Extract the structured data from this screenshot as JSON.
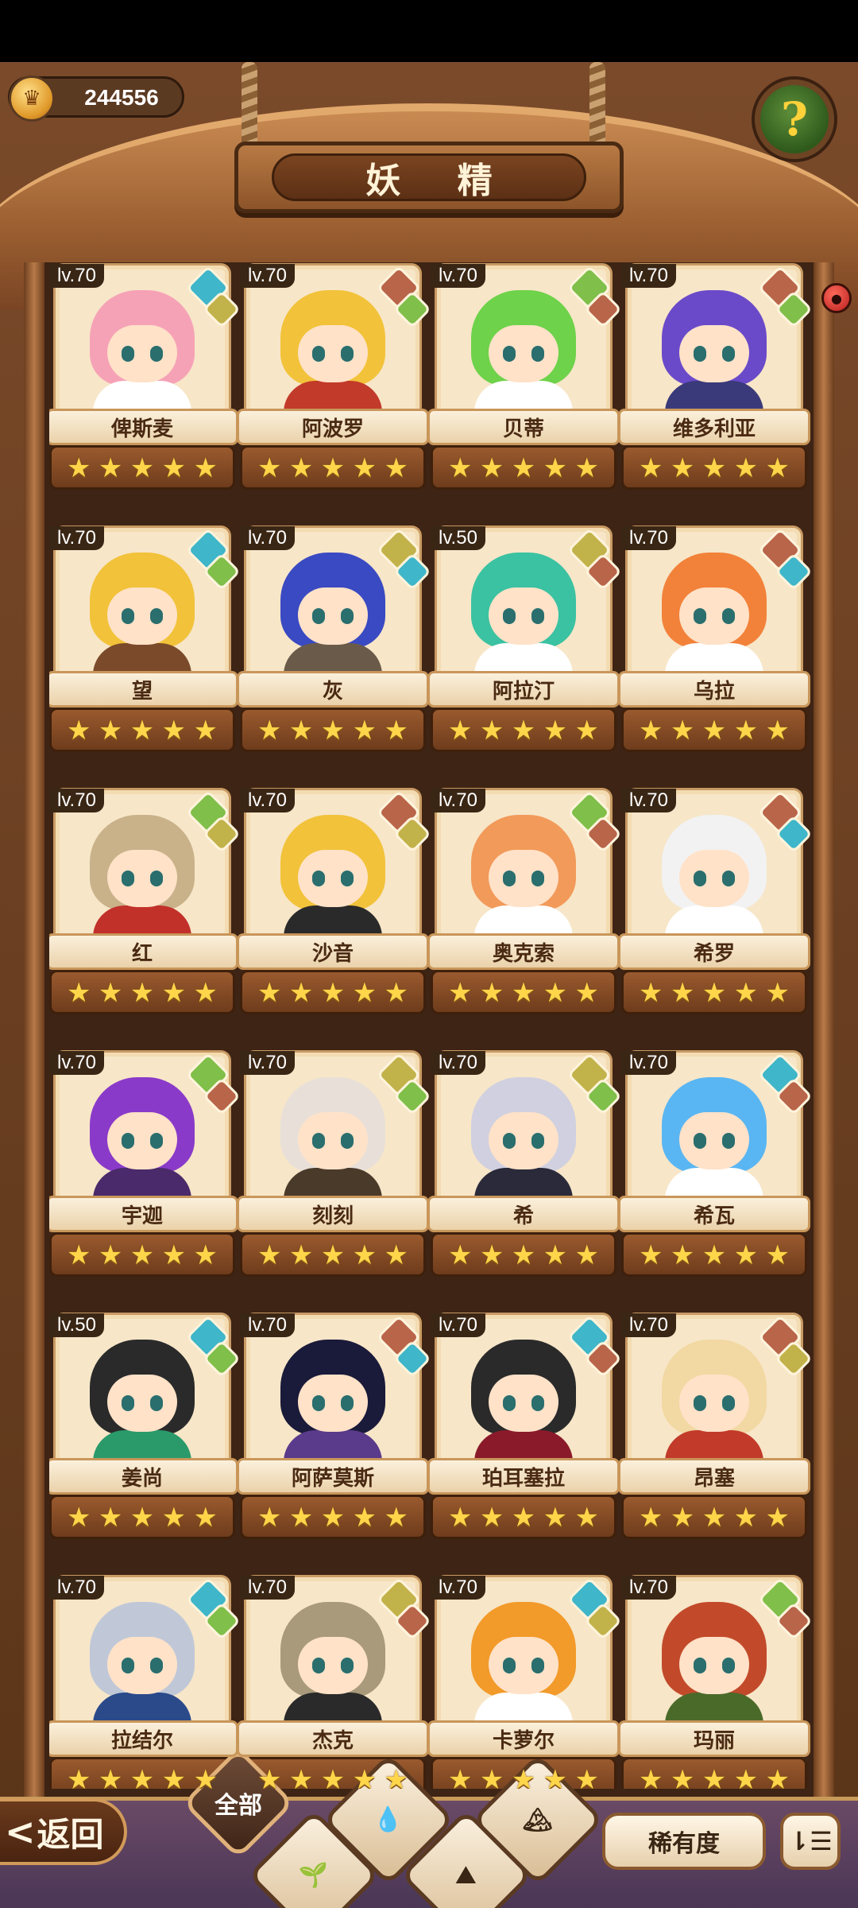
{
  "header": {
    "currency_value": "244556",
    "title": "妖 精",
    "help_glyph": "?"
  },
  "fairies": [
    {
      "level": "lv.70",
      "name": "俾斯麦",
      "stars": 5,
      "gems": [
        "#3fb6c9",
        "#c2b24a"
      ],
      "hair": "#f6a2b6",
      "outfit": "#ffffff"
    },
    {
      "level": "lv.70",
      "name": "阿波罗",
      "stars": 5,
      "gems": [
        "#b9654a",
        "#7fbf4a"
      ],
      "hair": "#f2c23a",
      "outfit": "#c23a2a"
    },
    {
      "level": "lv.70",
      "name": "贝蒂",
      "stars": 5,
      "gems": [
        "#7fbf4a",
        "#b9654a"
      ],
      "hair": "#6ed24a",
      "outfit": "#ffffff"
    },
    {
      "level": "lv.70",
      "name": "维多利亚",
      "stars": 5,
      "gems": [
        "#b9654a",
        "#7fbf4a"
      ],
      "hair": "#6a4ac9",
      "outfit": "#3a3a7a"
    },
    {
      "level": "lv.70",
      "name": "望",
      "stars": 5,
      "gems": [
        "#3fb6c9",
        "#7fbf4a"
      ],
      "hair": "#f2c23a",
      "outfit": "#7a4a2a"
    },
    {
      "level": "lv.70",
      "name": "灰",
      "stars": 5,
      "gems": [
        "#c2b24a",
        "#3fb6c9"
      ],
      "hair": "#3a4ac2",
      "outfit": "#6a5a4a"
    },
    {
      "level": "lv.50",
      "name": "阿拉汀",
      "stars": 5,
      "gems": [
        "#c2b24a",
        "#b9654a"
      ],
      "hair": "#3ac2a2",
      "outfit": "#ffffff"
    },
    {
      "level": "lv.70",
      "name": "乌拉",
      "stars": 5,
      "gems": [
        "#b9654a",
        "#3fb6c9"
      ],
      "hair": "#f2823a",
      "outfit": "#ffffff"
    },
    {
      "level": "lv.70",
      "name": "红",
      "stars": 5,
      "gems": [
        "#7fbf4a",
        "#c2b24a"
      ],
      "hair": "#c9b28a",
      "outfit": "#c2302a"
    },
    {
      "level": "lv.70",
      "name": "沙音",
      "stars": 5,
      "gems": [
        "#b9654a",
        "#c2b24a"
      ],
      "hair": "#f2c23a",
      "outfit": "#2a2a2a"
    },
    {
      "level": "lv.70",
      "name": "奥克索",
      "stars": 5,
      "gems": [
        "#7fbf4a",
        "#b9654a"
      ],
      "hair": "#f29a5a",
      "outfit": "#ffffff"
    },
    {
      "level": "lv.70",
      "name": "希罗",
      "stars": 5,
      "gems": [
        "#b9654a",
        "#3fb6c9"
      ],
      "hair": "#f2f2f2",
      "outfit": "#ffffff"
    },
    {
      "level": "lv.70",
      "name": "宇迦",
      "stars": 5,
      "gems": [
        "#7fbf4a",
        "#b9654a"
      ],
      "hair": "#8a3ac9",
      "outfit": "#4a2a6a"
    },
    {
      "level": "lv.70",
      "name": "刻刻",
      "stars": 5,
      "gems": [
        "#c2b24a",
        "#7fbf4a"
      ],
      "hair": "#e8e0d8",
      "outfit": "#4a3a2a"
    },
    {
      "level": "lv.70",
      "name": "希",
      "stars": 5,
      "gems": [
        "#c2b24a",
        "#7fbf4a"
      ],
      "hair": "#d0d0e0",
      "outfit": "#2a2a3a"
    },
    {
      "level": "lv.70",
      "name": "希瓦",
      "stars": 5,
      "gems": [
        "#3fb6c9",
        "#b9654a"
      ],
      "hair": "#5ab6f2",
      "outfit": "#ffffff"
    },
    {
      "level": "lv.50",
      "name": "姜尚",
      "stars": 5,
      "gems": [
        "#3fb6c9",
        "#7fbf4a"
      ],
      "hair": "#2a2a2a",
      "outfit": "#2a9a6a"
    },
    {
      "level": "lv.70",
      "name": "阿萨莫斯",
      "stars": 5,
      "gems": [
        "#b9654a",
        "#3fb6c9"
      ],
      "hair": "#1a1a3a",
      "outfit": "#5a3a8a"
    },
    {
      "level": "lv.70",
      "name": "珀耳塞拉",
      "stars": 5,
      "gems": [
        "#3fb6c9",
        "#b9654a"
      ],
      "hair": "#2a2a2a",
      "outfit": "#8a1a2a"
    },
    {
      "level": "lv.70",
      "name": "昂塞",
      "stars": 5,
      "gems": [
        "#b9654a",
        "#c2b24a"
      ],
      "hair": "#f2d8a2",
      "outfit": "#c23a2a"
    },
    {
      "level": "lv.70",
      "name": "拉结尔",
      "stars": 5,
      "gems": [
        "#3fb6c9",
        "#7fbf4a"
      ],
      "hair": "#c0c8d8",
      "outfit": "#2a4a8a"
    },
    {
      "level": "lv.70",
      "name": "杰克",
      "stars": 5,
      "gems": [
        "#c2b24a",
        "#b9654a"
      ],
      "hair": "#a89a7a",
      "outfit": "#2a2a2a"
    },
    {
      "level": "lv.70",
      "name": "卡萝尔",
      "stars": 5,
      "gems": [
        "#3fb6c9",
        "#c2b24a"
      ],
      "hair": "#f29a2a",
      "outfit": "#ffffff"
    },
    {
      "level": "lv.70",
      "name": "玛丽",
      "stars": 5,
      "gems": [
        "#7fbf4a",
        "#b9654a"
      ],
      "hair": "#c24a2a",
      "outfit": "#4a6a2a"
    }
  ],
  "bottom": {
    "back_label": "返回",
    "back_chevron": "<",
    "filter_all_label": "全部",
    "filter_icons": [
      "water-drop-icon",
      "leaf-icon",
      "mountain-icon",
      "snow-mountain-icon"
    ],
    "rarity_label": "稀有度",
    "sort_glyph": "⇂☰"
  }
}
